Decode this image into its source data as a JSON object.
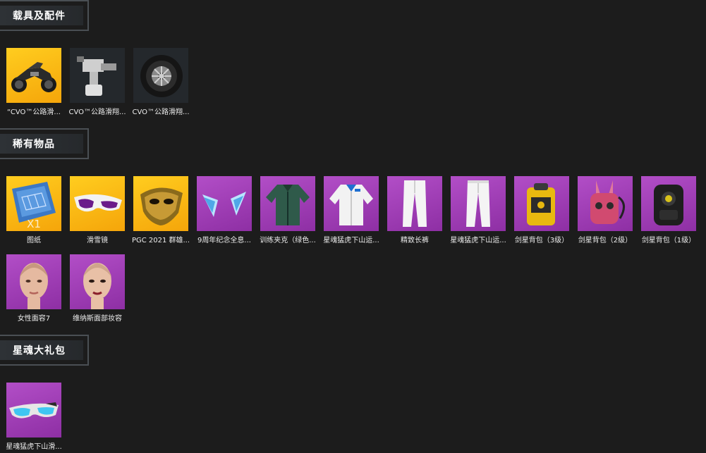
{
  "sections": {
    "vehicles": {
      "title": "载具及配件",
      "items": [
        {
          "label": "“CVO™公路滑...",
          "rarity": "yellow",
          "icon": "motorcycle-icon"
        },
        {
          "label": "CVO™公路滑翔...",
          "rarity": "dark",
          "icon": "engine-part-icon"
        },
        {
          "label": "CVO™公路滑翔...",
          "rarity": "dark",
          "icon": "wheel-icon"
        }
      ]
    },
    "rare": {
      "title": "稀有物品",
      "items": [
        {
          "label": "图纸",
          "rarity": "yellow",
          "icon": "blueprint-icon",
          "qty": "X1"
        },
        {
          "label": "滑雪镜",
          "rarity": "yellow",
          "icon": "ski-goggles-icon"
        },
        {
          "label": "PGC 2021 群雄...",
          "rarity": "yellow",
          "icon": "gold-mask-icon"
        },
        {
          "label": "9周年纪念全息...",
          "rarity": "purple",
          "icon": "hologram-ears-icon"
        },
        {
          "label": "训练夹克（绿色...",
          "rarity": "purple",
          "icon": "green-jacket-icon"
        },
        {
          "label": "星魂猛虎下山运...",
          "rarity": "purple",
          "icon": "white-jacket-icon"
        },
        {
          "label": "精致长裤",
          "rarity": "purple",
          "icon": "white-pants-icon"
        },
        {
          "label": "星魂猛虎下山运...",
          "rarity": "purple",
          "icon": "white-pants-icon"
        },
        {
          "label": "剑星背包（3级）",
          "rarity": "purple",
          "icon": "yellow-backpack-icon"
        },
        {
          "label": "剑星背包（2级）",
          "rarity": "purple",
          "icon": "pink-backpack-icon"
        },
        {
          "label": "剑星背包（1级）",
          "rarity": "purple",
          "icon": "black-backpack-icon"
        },
        {
          "label": "女性面容7",
          "rarity": "purple",
          "icon": "female-face-icon"
        },
        {
          "label": "维纳斯面部妆容",
          "rarity": "purple",
          "icon": "female-makeup-face-icon"
        }
      ]
    },
    "gift": {
      "title": "星魂大礼包",
      "items": [
        {
          "label": "星魂猛虎下山滑...",
          "rarity": "purple",
          "icon": "blue-goggles-icon"
        }
      ]
    }
  }
}
